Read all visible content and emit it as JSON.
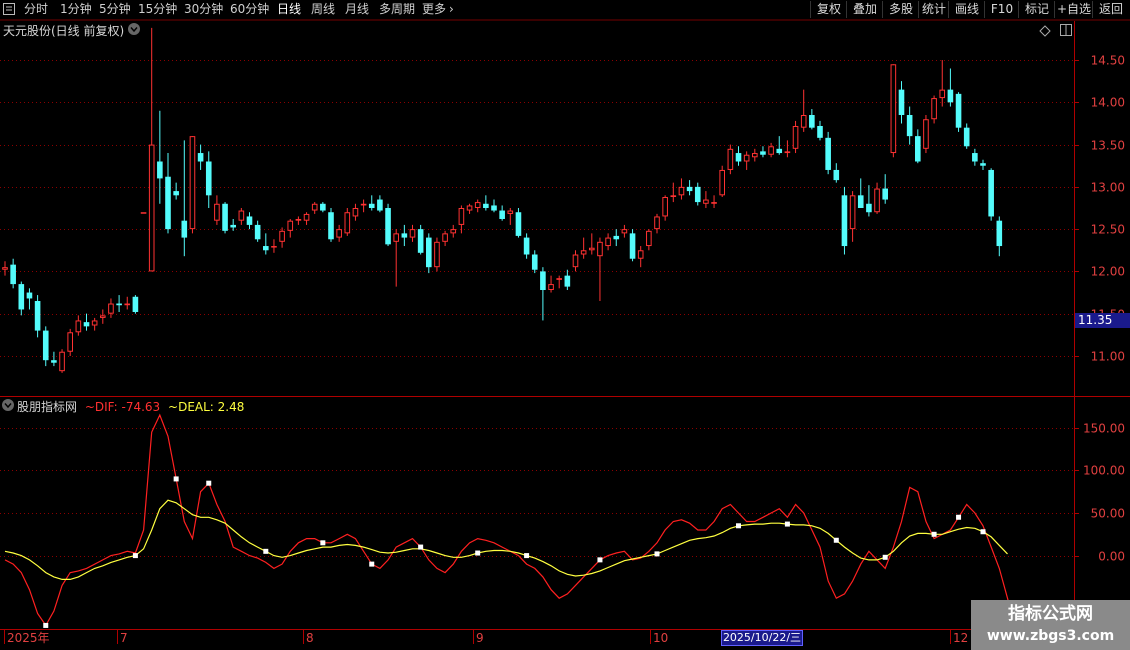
{
  "toolbar": {
    "periods": [
      "分时",
      "1分钟",
      "5分钟",
      "15分钟",
      "30分钟",
      "60分钟",
      "日线",
      "周线",
      "月线",
      "多周期",
      "更多"
    ],
    "active": "日线",
    "right_buttons": [
      "复权",
      "叠加",
      "多股",
      "统计",
      "画线",
      "F10",
      "标记",
      "+自选",
      "返回"
    ]
  },
  "stock": {
    "title": "天元股份(日线 前复权)",
    "current_price_label": "11.35"
  },
  "indicator": {
    "name": "股朋指标网",
    "dif_label": "~DIF: -74.63",
    "deal_label": "~DEAL: 2.48"
  },
  "x_axis": {
    "labels": [
      "2025年",
      "7",
      "8",
      "9",
      "10",
      "2025/10/22/三",
      "12"
    ]
  },
  "colors": {
    "up": "#ff3232",
    "down": "#54fcfc",
    "dif": "#ff2020",
    "deal": "#ffff40",
    "grid": "#8b0000"
  },
  "watermark": {
    "line1": "指标公式网",
    "line2": "www.zbgs3.com"
  },
  "chart_data": [
    {
      "type": "candlestick",
      "title": "天元股份(日线 前复权)",
      "y_ticks": [
        11.0,
        11.5,
        12.0,
        12.5,
        13.0,
        13.5,
        14.0,
        14.5
      ],
      "ylim": [
        10.55,
        14.95
      ],
      "candles": [
        [
          12.02,
          12.12,
          11.95,
          12.05
        ],
        [
          12.08,
          12.15,
          11.8,
          11.85
        ],
        [
          11.85,
          11.88,
          11.48,
          11.55
        ],
        [
          11.75,
          11.8,
          11.55,
          11.68
        ],
        [
          11.65,
          11.72,
          11.22,
          11.3
        ],
        [
          11.3,
          11.35,
          10.88,
          10.95
        ],
        [
          10.95,
          11.05,
          10.88,
          10.92
        ],
        [
          10.82,
          11.08,
          10.8,
          11.05
        ],
        [
          11.05,
          11.32,
          11.0,
          11.28
        ],
        [
          11.28,
          11.48,
          11.24,
          11.42
        ],
        [
          11.4,
          11.5,
          11.3,
          11.35
        ],
        [
          11.36,
          11.45,
          11.3,
          11.42
        ],
        [
          11.45,
          11.55,
          11.38,
          11.48
        ],
        [
          11.5,
          11.68,
          11.45,
          11.62
        ],
        [
          11.62,
          11.72,
          11.52,
          11.6
        ],
        [
          11.6,
          11.7,
          11.55,
          11.62
        ],
        [
          11.7,
          11.72,
          11.5,
          11.52
        ],
        [
          12.7,
          12.7,
          12.7,
          12.7
        ],
        [
          12.0,
          14.88,
          12.0,
          13.5
        ],
        [
          13.3,
          13.9,
          12.8,
          13.1
        ],
        [
          13.12,
          13.4,
          12.45,
          12.5
        ],
        [
          12.95,
          13.05,
          12.85,
          12.9
        ],
        [
          12.6,
          13.55,
          12.18,
          12.4
        ],
        [
          12.5,
          13.6,
          12.45,
          13.6
        ],
        [
          13.4,
          13.5,
          13.2,
          13.3
        ],
        [
          13.3,
          13.42,
          12.75,
          12.9
        ],
        [
          12.6,
          12.9,
          12.55,
          12.8
        ],
        [
          12.8,
          12.82,
          12.45,
          12.48
        ],
        [
          12.55,
          12.62,
          12.48,
          12.52
        ],
        [
          12.6,
          12.75,
          12.55,
          12.72
        ],
        [
          12.65,
          12.7,
          12.5,
          12.55
        ],
        [
          12.55,
          12.6,
          12.35,
          12.38
        ],
        [
          12.3,
          12.45,
          12.2,
          12.25
        ],
        [
          12.3,
          12.38,
          12.22,
          12.3
        ],
        [
          12.35,
          12.52,
          12.28,
          12.48
        ],
        [
          12.48,
          12.62,
          12.4,
          12.6
        ],
        [
          12.6,
          12.65,
          12.55,
          12.62
        ],
        [
          12.6,
          12.7,
          12.55,
          12.68
        ],
        [
          12.72,
          12.82,
          12.68,
          12.8
        ],
        [
          12.8,
          12.82,
          12.7,
          12.72
        ],
        [
          12.7,
          12.75,
          12.35,
          12.38
        ],
        [
          12.4,
          12.55,
          12.35,
          12.5
        ],
        [
          12.45,
          12.75,
          12.42,
          12.7
        ],
        [
          12.65,
          12.8,
          12.6,
          12.75
        ],
        [
          12.78,
          12.85,
          12.7,
          12.8
        ],
        [
          12.8,
          12.9,
          12.72,
          12.75
        ],
        [
          12.85,
          12.9,
          12.7,
          12.72
        ],
        [
          12.75,
          12.8,
          12.3,
          12.32
        ],
        [
          12.35,
          12.5,
          11.82,
          12.45
        ],
        [
          12.45,
          12.55,
          12.3,
          12.4
        ],
        [
          12.4,
          12.55,
          12.35,
          12.5
        ],
        [
          12.5,
          12.55,
          12.2,
          12.22
        ],
        [
          12.4,
          12.45,
          11.98,
          12.05
        ],
        [
          12.05,
          12.4,
          12.0,
          12.35
        ],
        [
          12.35,
          12.48,
          12.3,
          12.45
        ],
        [
          12.45,
          12.55,
          12.4,
          12.5
        ],
        [
          12.55,
          12.78,
          12.45,
          12.75
        ],
        [
          12.72,
          12.8,
          12.68,
          12.78
        ],
        [
          12.75,
          12.85,
          12.7,
          12.82
        ],
        [
          12.8,
          12.9,
          12.72,
          12.75
        ],
        [
          12.78,
          12.85,
          12.7,
          12.72
        ],
        [
          12.72,
          12.78,
          12.6,
          12.62
        ],
        [
          12.68,
          12.75,
          12.55,
          12.72
        ],
        [
          12.7,
          12.75,
          12.4,
          12.42
        ],
        [
          12.4,
          12.45,
          12.15,
          12.2
        ],
        [
          12.2,
          12.25,
          11.98,
          12.02
        ],
        [
          12.0,
          12.05,
          11.42,
          11.78
        ],
        [
          11.78,
          11.95,
          11.75,
          11.85
        ],
        [
          11.9,
          11.95,
          11.8,
          11.92
        ],
        [
          11.95,
          12.02,
          11.78,
          11.82
        ],
        [
          12.05,
          12.25,
          12.0,
          12.2
        ],
        [
          12.2,
          12.4,
          12.15,
          12.25
        ],
        [
          12.25,
          12.45,
          12.2,
          12.28
        ],
        [
          12.18,
          12.4,
          11.65,
          12.35
        ],
        [
          12.3,
          12.45,
          12.25,
          12.4
        ],
        [
          12.42,
          12.5,
          12.3,
          12.38
        ],
        [
          12.45,
          12.55,
          12.4,
          12.5
        ],
        [
          12.45,
          12.5,
          12.12,
          12.15
        ],
        [
          12.15,
          12.3,
          12.05,
          12.25
        ],
        [
          12.3,
          12.5,
          12.25,
          12.48
        ],
        [
          12.5,
          12.68,
          12.45,
          12.65
        ],
        [
          12.65,
          12.9,
          12.6,
          12.88
        ],
        [
          12.88,
          13.05,
          12.82,
          12.9
        ],
        [
          12.9,
          13.1,
          12.85,
          13.0
        ],
        [
          13.0,
          13.08,
          12.9,
          12.95
        ],
        [
          13.0,
          13.05,
          12.78,
          12.82
        ],
        [
          12.8,
          12.95,
          12.75,
          12.85
        ],
        [
          12.8,
          12.9,
          12.75,
          12.82
        ],
        [
          12.9,
          13.25,
          12.88,
          13.2
        ],
        [
          13.2,
          13.5,
          13.15,
          13.45
        ],
        [
          13.4,
          13.48,
          13.25,
          13.3
        ],
        [
          13.3,
          13.42,
          13.2,
          13.38
        ],
        [
          13.35,
          13.45,
          13.3,
          13.4
        ],
        [
          13.42,
          13.48,
          13.35,
          13.38
        ],
        [
          13.38,
          13.52,
          13.35,
          13.48
        ],
        [
          13.45,
          13.6,
          13.38,
          13.4
        ],
        [
          13.4,
          13.55,
          13.35,
          13.42
        ],
        [
          13.45,
          13.78,
          13.4,
          13.72
        ],
        [
          13.7,
          14.15,
          13.65,
          13.85
        ],
        [
          13.85,
          13.92,
          13.68,
          13.7
        ],
        [
          13.72,
          13.78,
          13.55,
          13.58
        ],
        [
          13.58,
          13.65,
          13.15,
          13.2
        ],
        [
          13.2,
          13.28,
          13.05,
          13.08
        ],
        [
          12.9,
          13.0,
          12.2,
          12.3
        ],
        [
          12.5,
          12.95,
          12.35,
          12.9
        ],
        [
          12.9,
          13.1,
          12.75,
          12.75
        ],
        [
          12.8,
          13.02,
          12.65,
          12.7
        ],
        [
          12.7,
          13.05,
          12.68,
          12.98
        ],
        [
          12.98,
          13.15,
          12.8,
          12.85
        ],
        [
          13.4,
          14.45,
          13.35,
          14.45
        ],
        [
          14.15,
          14.25,
          13.75,
          13.85
        ],
        [
          13.85,
          13.95,
          13.5,
          13.6
        ],
        [
          13.6,
          13.68,
          13.28,
          13.3
        ],
        [
          13.45,
          13.85,
          13.4,
          13.8
        ],
        [
          13.8,
          14.08,
          13.75,
          14.05
        ],
        [
          14.05,
          14.5,
          13.95,
          14.15
        ],
        [
          14.15,
          14.4,
          13.95,
          14.0
        ],
        [
          14.1,
          14.12,
          13.65,
          13.7
        ],
        [
          13.7,
          13.75,
          13.45,
          13.48
        ],
        [
          13.4,
          13.45,
          13.25,
          13.3
        ],
        [
          13.28,
          13.32,
          13.2,
          13.25
        ],
        [
          13.2,
          13.22,
          12.6,
          12.65
        ],
        [
          12.6,
          12.65,
          12.18,
          12.3
        ]
      ]
    },
    {
      "type": "line",
      "title": "股朋指标网",
      "y_ticks": [
        0.0,
        50.0,
        100.0,
        150.0
      ],
      "ylim": [
        -85,
        185
      ],
      "series": [
        {
          "name": "DIF",
          "values": [
            -5,
            -10,
            -20,
            -40,
            -68,
            -82,
            -65,
            -35,
            -20,
            -18,
            -15,
            -10,
            -5,
            0,
            2,
            5,
            3,
            30,
            145,
            165,
            140,
            90,
            40,
            20,
            75,
            85,
            60,
            40,
            10,
            5,
            0,
            -3,
            -8,
            -15,
            -10,
            5,
            15,
            20,
            20,
            15,
            15,
            20,
            25,
            20,
            5,
            -10,
            -15,
            -5,
            10,
            15,
            20,
            10,
            -5,
            -15,
            -20,
            -10,
            5,
            15,
            20,
            18,
            15,
            10,
            5,
            0,
            -10,
            -15,
            -25,
            -40,
            -50,
            -45,
            -35,
            -25,
            -15,
            -5,
            0,
            3,
            5,
            -5,
            -3,
            5,
            15,
            30,
            40,
            42,
            38,
            30,
            30,
            40,
            55,
            60,
            50,
            40,
            40,
            45,
            50,
            55,
            45,
            60,
            50,
            30,
            10,
            -30,
            -50,
            -45,
            -30,
            -10,
            5,
            -5,
            -15,
            10,
            40,
            80,
            75,
            40,
            20,
            25,
            30,
            45,
            60,
            50,
            35,
            10,
            -15,
            -50,
            -85
          ]
        },
        {
          "name": "DEAL",
          "values": [
            5,
            3,
            0,
            -5,
            -12,
            -20,
            -25,
            -28,
            -28,
            -25,
            -20,
            -15,
            -12,
            -8,
            -5,
            -2,
            0,
            8,
            30,
            55,
            65,
            62,
            55,
            48,
            45,
            45,
            42,
            38,
            30,
            22,
            15,
            10,
            5,
            0,
            -2,
            0,
            3,
            6,
            8,
            10,
            10,
            12,
            13,
            12,
            10,
            7,
            4,
            3,
            4,
            6,
            8,
            8,
            6,
            3,
            0,
            -2,
            -2,
            0,
            3,
            5,
            6,
            6,
            5,
            3,
            0,
            -3,
            -7,
            -12,
            -18,
            -22,
            -24,
            -23,
            -21,
            -18,
            -14,
            -10,
            -6,
            -4,
            -2,
            0,
            2,
            6,
            10,
            14,
            18,
            20,
            21,
            23,
            27,
            32,
            35,
            36,
            37,
            37,
            38,
            38,
            37,
            36,
            36,
            35,
            32,
            26,
            18,
            10,
            3,
            -3,
            -5,
            -5,
            -2,
            5,
            15,
            23,
            26,
            26,
            25,
            25,
            28,
            31,
            33,
            32,
            28,
            22,
            12,
            2
          ]
        }
      ]
    }
  ]
}
